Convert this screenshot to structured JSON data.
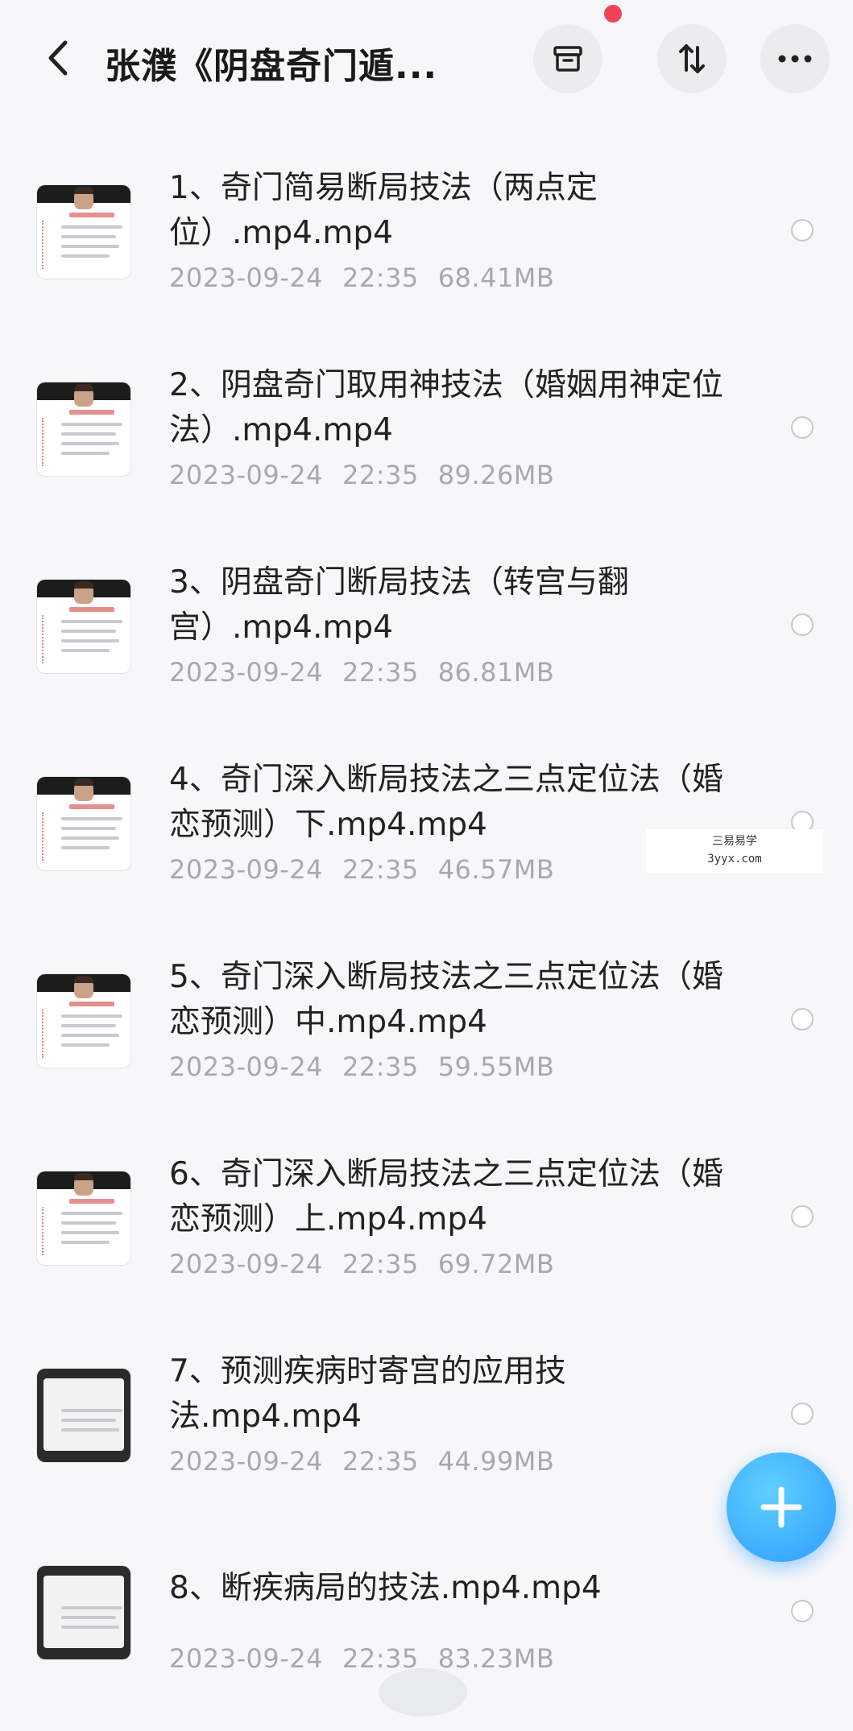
{
  "header": {
    "title": "张濮《阴盘奇门遁...",
    "icons": {
      "back": "chevron-left-icon",
      "archive": "archive-box-icon",
      "sort": "sort-arrows-icon",
      "more": "more-dots-icon"
    },
    "notification_dot_color": "#f0435a"
  },
  "files": [
    {
      "name": "1、奇门简易断局技法（两点定位）.mp4.mp4",
      "date": "2023-09-24",
      "time": "22:35",
      "size": "68.41MB",
      "thumb": "light"
    },
    {
      "name": "2、阴盘奇门取用神技法（婚姻用神定位法）.mp4.mp4",
      "date": "2023-09-24",
      "time": "22:35",
      "size": "89.26MB",
      "thumb": "light"
    },
    {
      "name": "3、阴盘奇门断局技法（转宫与翻宫）.mp4.mp4",
      "date": "2023-09-24",
      "time": "22:35",
      "size": "86.81MB",
      "thumb": "light"
    },
    {
      "name": "4、奇门深入断局技法之三点定位法（婚恋预测）下.mp4.mp4",
      "date": "2023-09-24",
      "time": "22:35",
      "size": "46.57MB",
      "thumb": "light"
    },
    {
      "name": "5、奇门深入断局技法之三点定位法（婚恋预测）中.mp4.mp4",
      "date": "2023-09-24",
      "time": "22:35",
      "size": "59.55MB",
      "thumb": "light"
    },
    {
      "name": "6、奇门深入断局技法之三点定位法（婚恋预测）上.mp4.mp4",
      "date": "2023-09-24",
      "time": "22:35",
      "size": "69.72MB",
      "thumb": "light"
    },
    {
      "name": "7、预测疾病时寄宫的应用技法.mp4.mp4",
      "date": "2023-09-24",
      "time": "22:35",
      "size": "44.99MB",
      "thumb": "dark"
    },
    {
      "name": "8、断疾病局的技法.mp4.mp4",
      "date": "2023-09-24",
      "time": "22:35",
      "size": "83.23MB",
      "thumb": "dark"
    }
  ],
  "fab": {
    "icon": "plus-icon",
    "color": "#2f9bff"
  },
  "watermark": {
    "line1": "三易易学",
    "line2": "3yyx.com"
  }
}
